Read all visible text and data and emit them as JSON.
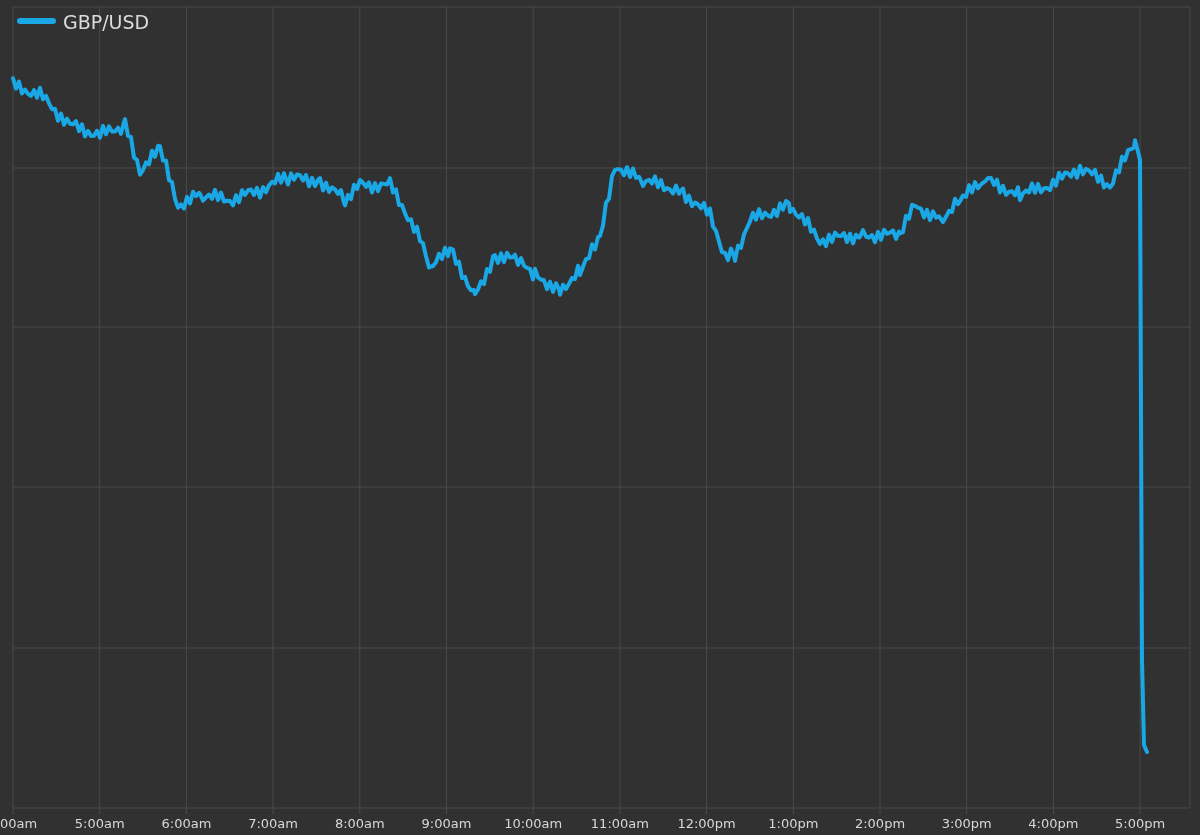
{
  "chart": {
    "legend": {
      "label": "GBP/USD"
    },
    "x_axis_labels": [
      "00am",
      "5:00am",
      "6:00am",
      "7:00am",
      "8:00am",
      "9:00am",
      "10:00am",
      "11:00am",
      "12:00pm",
      "1:00pm",
      "2:00pm",
      "3:00pm",
      "4:00pm",
      "5:00pm"
    ]
  }
}
